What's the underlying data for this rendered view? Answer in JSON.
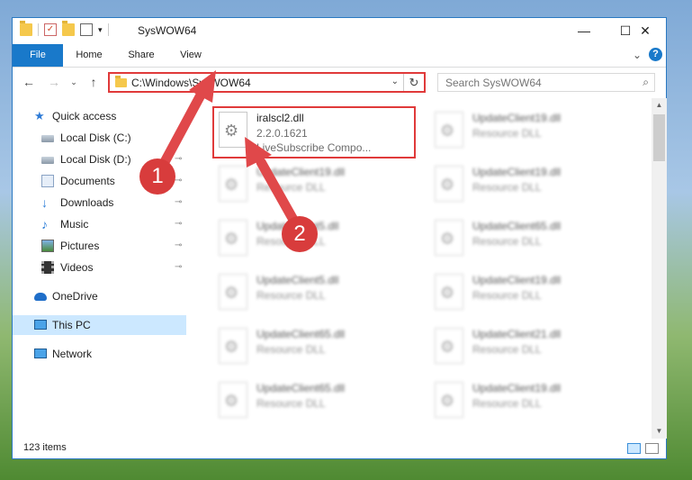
{
  "window": {
    "title": "SysWOW64",
    "controls": {
      "minimize": "—",
      "maximize": "☐",
      "close": "✕"
    }
  },
  "ribbon": {
    "tabs": [
      "File",
      "Home",
      "Share",
      "View"
    ],
    "chevron": "⌄",
    "help": "?"
  },
  "nav": {
    "back": "←",
    "forward": "→",
    "up": "↑",
    "recent": "⌄",
    "address": "C:\\Windows\\SysWOW64",
    "address_dropdown": "⌄",
    "refresh": "↻",
    "search_placeholder": "Search SysWOW64",
    "search_icon": "⌕"
  },
  "sidebar": {
    "items": [
      {
        "label": "Quick access",
        "icon": "star-icon",
        "pinned": false
      },
      {
        "label": "Local Disk (C:)",
        "icon": "drive-icon",
        "pinned": true
      },
      {
        "label": "Local Disk (D:)",
        "icon": "drive-icon",
        "pinned": true
      },
      {
        "label": "Documents",
        "icon": "documents-icon",
        "pinned": true
      },
      {
        "label": "Downloads",
        "icon": "download-icon",
        "pinned": true
      },
      {
        "label": "Music",
        "icon": "music-icon",
        "pinned": true
      },
      {
        "label": "Pictures",
        "icon": "pictures-icon",
        "pinned": true
      },
      {
        "label": "Videos",
        "icon": "videos-icon",
        "pinned": true
      },
      {
        "label": "OneDrive",
        "icon": "cloud-icon",
        "pinned": false
      },
      {
        "label": "This PC",
        "icon": "computer-icon",
        "pinned": false,
        "selected": true
      },
      {
        "label": "Network",
        "icon": "network-icon",
        "pinned": false
      }
    ],
    "pin_glyph": "📌"
  },
  "files": [
    {
      "name": "iralscl2.dll",
      "line2": "2.2.0.1621",
      "line3": "LiveSubscribe Compo...",
      "highlighted": true
    },
    {
      "name": "UpdateClient19.dll",
      "line2": "Resource DLL",
      "line3": ""
    },
    {
      "name": "UpdateClient19.dll",
      "line2": "Resource DLL",
      "line3": ""
    },
    {
      "name": "UpdateClient19.dll",
      "line2": "Resource DLL",
      "line3": ""
    },
    {
      "name": "UpdateClient5.dll",
      "line2": "Resource DLL",
      "line3": ""
    },
    {
      "name": "UpdateClient65.dll",
      "line2": "Resource DLL",
      "line3": ""
    },
    {
      "name": "UpdateClient5.dll",
      "line2": "Resource DLL",
      "line3": ""
    },
    {
      "name": "UpdateClient19.dll",
      "line2": "Resource DLL",
      "line3": ""
    },
    {
      "name": "UpdateClient65.dll",
      "line2": "Resource DLL",
      "line3": ""
    },
    {
      "name": "UpdateClient21.dll",
      "line2": "Resource DLL",
      "line3": ""
    },
    {
      "name": "UpdateClient65.dll",
      "line2": "Resource DLL",
      "line3": ""
    },
    {
      "name": "UpdateClient19.dll",
      "line2": "Resource DLL",
      "line3": ""
    }
  ],
  "status": {
    "item_count": "123 items"
  },
  "annotations": {
    "step1": "1",
    "step2": "2",
    "color": "#d83c3c"
  }
}
